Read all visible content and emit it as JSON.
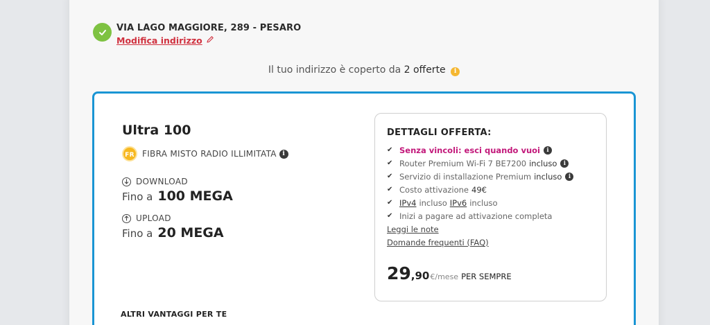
{
  "address": {
    "text": "VIA LAGO MAGGIORE, 289 - PESARO",
    "edit_label": "Modifica indirizzo"
  },
  "coverage": {
    "prefix": "Il tuo indirizzo è coperto da",
    "count": "2 offerte"
  },
  "offer": {
    "name": "Ultra 100",
    "tech_badge": "FR",
    "technology": "FIBRA MISTO RADIO ILLIMITATA",
    "download_label": "DOWNLOAD",
    "download_prefix": "Fino a",
    "download_value": "100 MEGA",
    "upload_label": "UPLOAD",
    "upload_prefix": "Fino a",
    "upload_value": "20 MEGA",
    "other_benefits": "ALTRI VANTAGGI PER TE"
  },
  "details": {
    "title": "DETTAGLI OFFERTA:",
    "items": [
      {
        "text": "Senza vincoli: esci quando vuoi"
      },
      {
        "text": "Router Premium Wi-Fi 7 BE7200",
        "suffix": "incluso"
      },
      {
        "text": "Servizio di installazione Premium",
        "suffix": "incluso"
      },
      {
        "text": "Costo attivazione",
        "suffix": "49€"
      },
      {
        "part1": "IPv4",
        "mid": "incluso",
        "part2": "IPv6",
        "end": "incluso"
      },
      {
        "text": "Inizi a pagare ad attivazione completa"
      }
    ],
    "notes_link": "Leggi le note",
    "faq_link": "Domande frequenti (FAQ)",
    "price_int": "29",
    "price_dec": ",90",
    "price_unit": "€/mese",
    "price_forever": "PER SEMPRE"
  },
  "colors": {
    "accent_blue": "#1a95d4",
    "check_green": "#7ec242",
    "edit_red": "#d0313f",
    "highlight_magenta": "#c2187a",
    "info_yellow": "#f5b731"
  },
  "icons": {
    "address_status": "check-icon",
    "edit": "pencil-icon",
    "info": "info-icon",
    "download": "arrow-down-circle-icon",
    "upload": "arrow-up-circle-icon",
    "tick": "checkmark-icon"
  }
}
